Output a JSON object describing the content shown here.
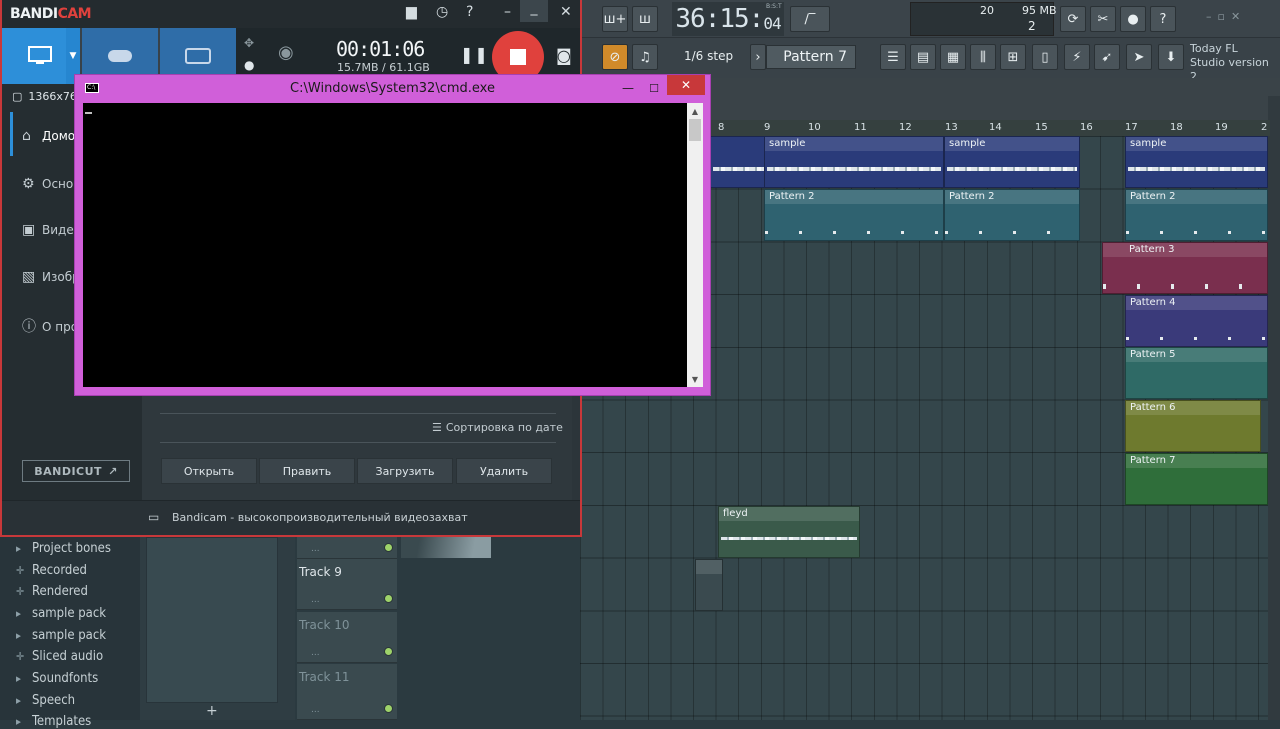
{
  "fl": {
    "time_main": "36:15:",
    "time_sub": "04",
    "bst": "B:S:T",
    "cpu": "20",
    "mem": "95 MB",
    "poly": "2",
    "step": "1/6 step",
    "pattern": "Pattern 7",
    "news_line1": "Today  FL",
    "news_line2": "Studio version 2.",
    "ruler": [
      "8",
      "9",
      "10",
      "11",
      "12",
      "13",
      "14",
      "15",
      "16",
      "17",
      "18",
      "19",
      "2"
    ],
    "clips": [
      {
        "label": "sample"
      },
      {
        "label": "sample"
      },
      {
        "label": "sample"
      },
      {
        "label": "Pattern 2"
      },
      {
        "label": "Pattern 2"
      },
      {
        "label": "Pattern 2"
      },
      {
        "label": "Pattern 3"
      },
      {
        "label": "Pattern 4"
      },
      {
        "label": "Pattern 5"
      },
      {
        "label": "Pattern 6"
      },
      {
        "label": "Pattern 7"
      },
      {
        "label": "fleyd"
      }
    ],
    "clip_colors": {
      "sample": "#2a3b7a",
      "pattern2": "#2f6270",
      "pattern3": "#7a2f4e",
      "pattern4": "#3a3a7a",
      "pattern5": "#2f6a66",
      "pattern6": "#6e7a2e",
      "pattern7": "#2f6e3a",
      "fleyd": "#3a5a4a"
    },
    "tracks": [
      "Track 9",
      "Track 10",
      "Track 11"
    ],
    "browser": [
      "Project bones",
      "Recorded",
      "Rendered",
      "sample pack",
      "sample pack",
      "Sliced audio",
      "Soundfonts",
      "Speech",
      "Templates"
    ]
  },
  "bandicam": {
    "logo_a": "BANDI",
    "logo_b": "CAM",
    "timer": "00:01:06",
    "size": "15.7MB / 61.1GB",
    "resolution": "1366x768",
    "side": [
      "Домой",
      "Основные",
      "Видео",
      "Изображения",
      "О программе"
    ],
    "bandicut": "BANDICUT",
    "sort": "Сортировка по дате",
    "buttons": {
      "open": "Открыть",
      "edit": "Править",
      "upload": "Загрузить",
      "delete": "Удалить"
    },
    "status": "Bandicam - высокопроизводительный видеозахват",
    "accent": "#2d8fd9",
    "rec_color": "#e0413d"
  },
  "cmd": {
    "title": "C:\\Windows\\System32\\cmd.exe",
    "border_color": "#d05fd9",
    "close_color": "#c8383a"
  }
}
